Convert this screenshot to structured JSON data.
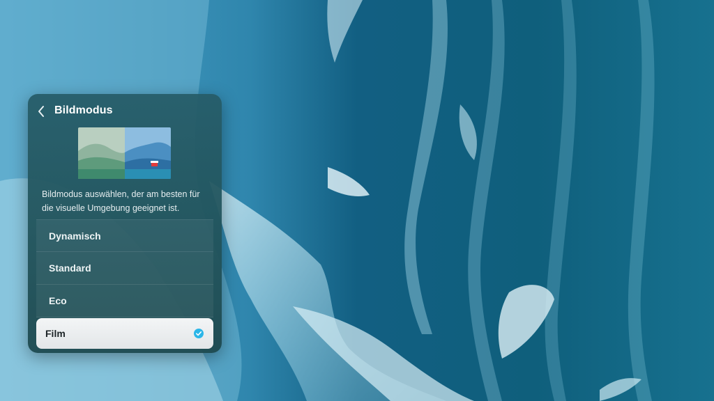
{
  "panel": {
    "title": "Bildmodus",
    "description": "Bildmodus auswählen, der am besten für die visuelle Umgebung geeignet ist."
  },
  "modes": [
    {
      "label": "Dynamisch",
      "selected": false
    },
    {
      "label": "Standard",
      "selected": false
    },
    {
      "label": "Eco",
      "selected": false
    },
    {
      "label": "Film",
      "selected": true
    }
  ],
  "icons": {
    "back": "chevron-left-icon",
    "check": "check-circle-icon"
  },
  "colors": {
    "accent": "#2bb6e8",
    "panel": "#265c68",
    "selected_bg": "#eef1f2"
  }
}
